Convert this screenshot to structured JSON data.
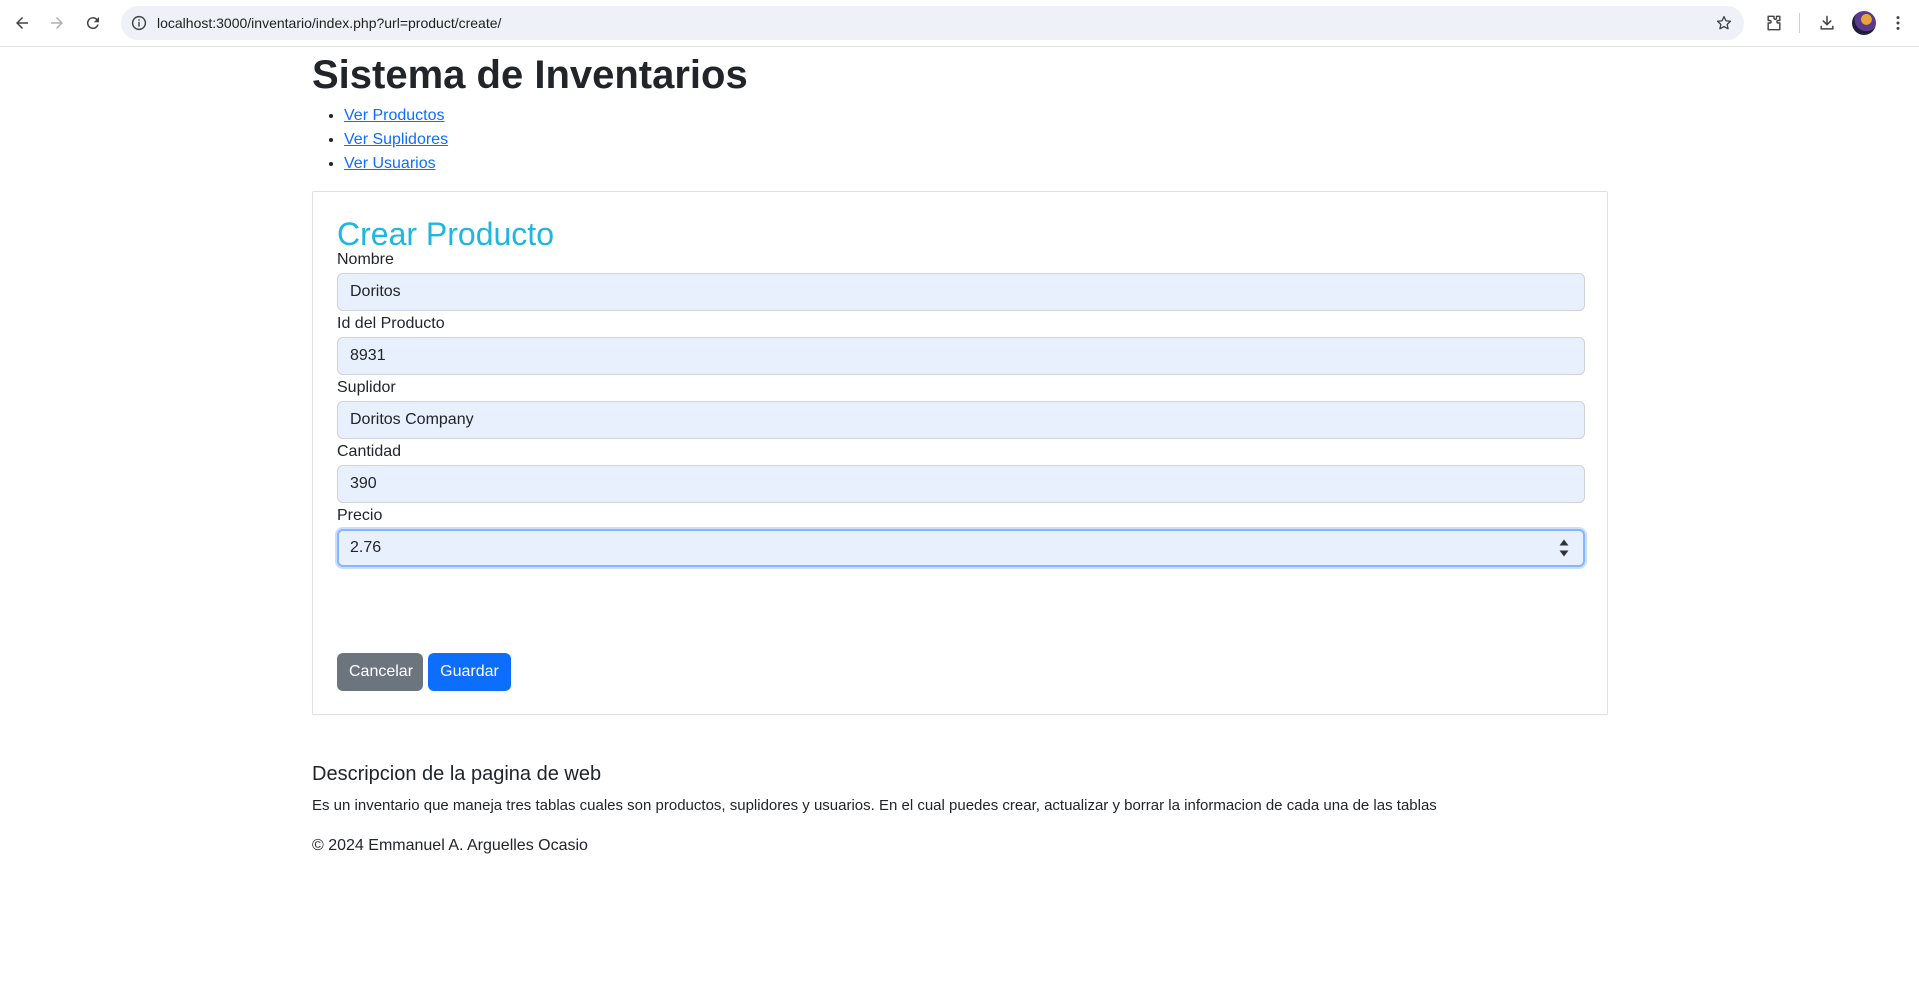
{
  "browser": {
    "url": "localhost:3000/inventario/index.php?url=product/create/"
  },
  "page": {
    "title": "Sistema de Inventarios",
    "nav": [
      {
        "label": "Ver Productos"
      },
      {
        "label": "Ver Suplidores"
      },
      {
        "label": "Ver Usuarios"
      }
    ]
  },
  "form": {
    "title": "Crear Producto",
    "fields": [
      {
        "label": "Nombre",
        "value": "Doritos"
      },
      {
        "label": "Id del Producto",
        "value": "8931"
      },
      {
        "label": "Suplidor",
        "value": "Doritos Company"
      },
      {
        "label": "Cantidad",
        "value": "390"
      },
      {
        "label": "Precio",
        "value": "2.76"
      }
    ],
    "cancel_label": "Cancelar",
    "save_label": "Guardar"
  },
  "footer": {
    "title": "Descripcion de la pagina de web",
    "description": "Es un inventario que maneja tres tablas cuales son productos, suplidores y usuarios. En el cual puedes crear, actualizar y borrar la informacion de cada una de las tablas",
    "copyright": "© 2024 Emmanuel A. Arguelles Ocasio"
  },
  "colors": {
    "form_title": "#1fb6df",
    "link": "#0d6efd",
    "primary_button": "#0d6efd",
    "secondary_button": "#6c757d",
    "input_autofill_bg": "#e8f0fe"
  }
}
